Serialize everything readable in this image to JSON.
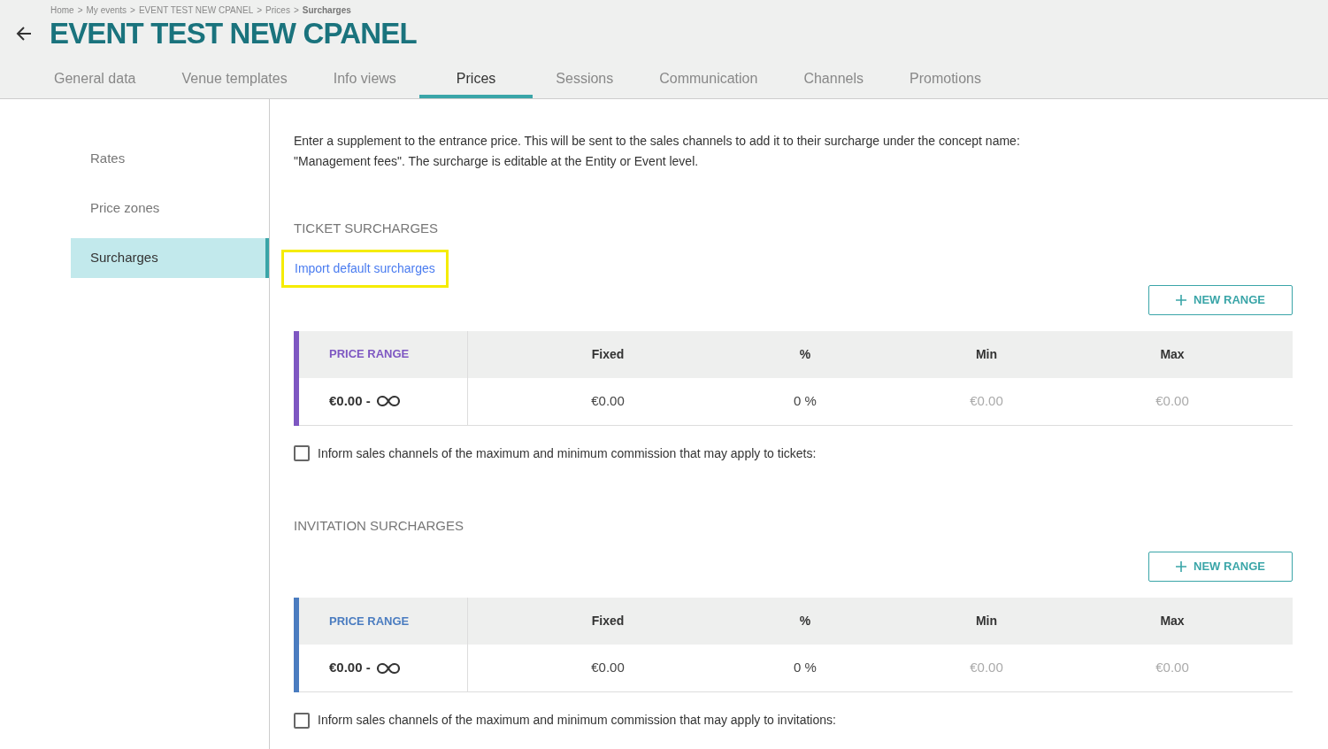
{
  "breadcrumb_separator": ">",
  "breadcrumb": [
    {
      "label": "Home",
      "current": false
    },
    {
      "label": "My events",
      "current": false
    },
    {
      "label": "EVENT TEST NEW CPANEL",
      "current": false
    },
    {
      "label": "Prices",
      "current": false
    },
    {
      "label": "Surcharges",
      "current": true
    }
  ],
  "title": "EVENT TEST NEW CPANEL",
  "tabs": [
    {
      "label": "General data",
      "selected": false
    },
    {
      "label": "Venue templates",
      "selected": false
    },
    {
      "label": "Info views",
      "selected": false
    },
    {
      "label": "Prices",
      "selected": true
    },
    {
      "label": "Sessions",
      "selected": false
    },
    {
      "label": "Communication",
      "selected": false
    },
    {
      "label": "Channels",
      "selected": false
    },
    {
      "label": "Promotions",
      "selected": false
    }
  ],
  "sidebar": {
    "items": [
      {
        "label": "Rates",
        "selected": false
      },
      {
        "label": "Price zones",
        "selected": false
      },
      {
        "label": "Surcharges",
        "selected": true
      }
    ]
  },
  "intro": "Enter a supplement to the entrance price. This will be sent to the sales channels to add it to their surcharge under the concept name: \"Management fees\". The surcharge is editable at the Entity or Event level.",
  "sections": [
    {
      "heading": "TICKET SURCHARGES",
      "link": {
        "label": "Import default surcharges",
        "highlighted": true
      },
      "button": "NEW RANGE",
      "color": "#7e57c2",
      "columns": [
        "PRICE RANGE",
        "Fixed",
        "%",
        "Min",
        "Max"
      ],
      "rows": [
        {
          "cells": [
            {
              "text": "€0.00 -",
              "disabled": false
            },
            {
              "text": "€0.00",
              "disabled": false
            },
            {
              "text": "0 %",
              "disabled": false
            },
            {
              "text": "€0.00",
              "disabled": true
            },
            {
              "text": "€0.00",
              "disabled": true
            }
          ]
        }
      ],
      "checkbox": {
        "label": "Inform sales channels of the maximum and minimum commission that may apply to tickets:",
        "checked": false
      }
    },
    {
      "heading": "INVITATION SURCHARGES",
      "button": "NEW RANGE",
      "color": "#4a7cc0",
      "columns": [
        "PRICE RANGE",
        "Fixed",
        "%",
        "Min",
        "Max"
      ],
      "rows": [
        {
          "cells": [
            {
              "text": "€0.00 -",
              "disabled": false
            },
            {
              "text": "€0.00",
              "disabled": false
            },
            {
              "text": "0 %",
              "disabled": false
            },
            {
              "text": "€0.00",
              "disabled": true
            },
            {
              "text": "€0.00",
              "disabled": true
            }
          ]
        }
      ],
      "checkbox": {
        "label": "Inform sales channels of the maximum and minimum commission that may apply to invitations:",
        "checked": false
      }
    }
  ]
}
